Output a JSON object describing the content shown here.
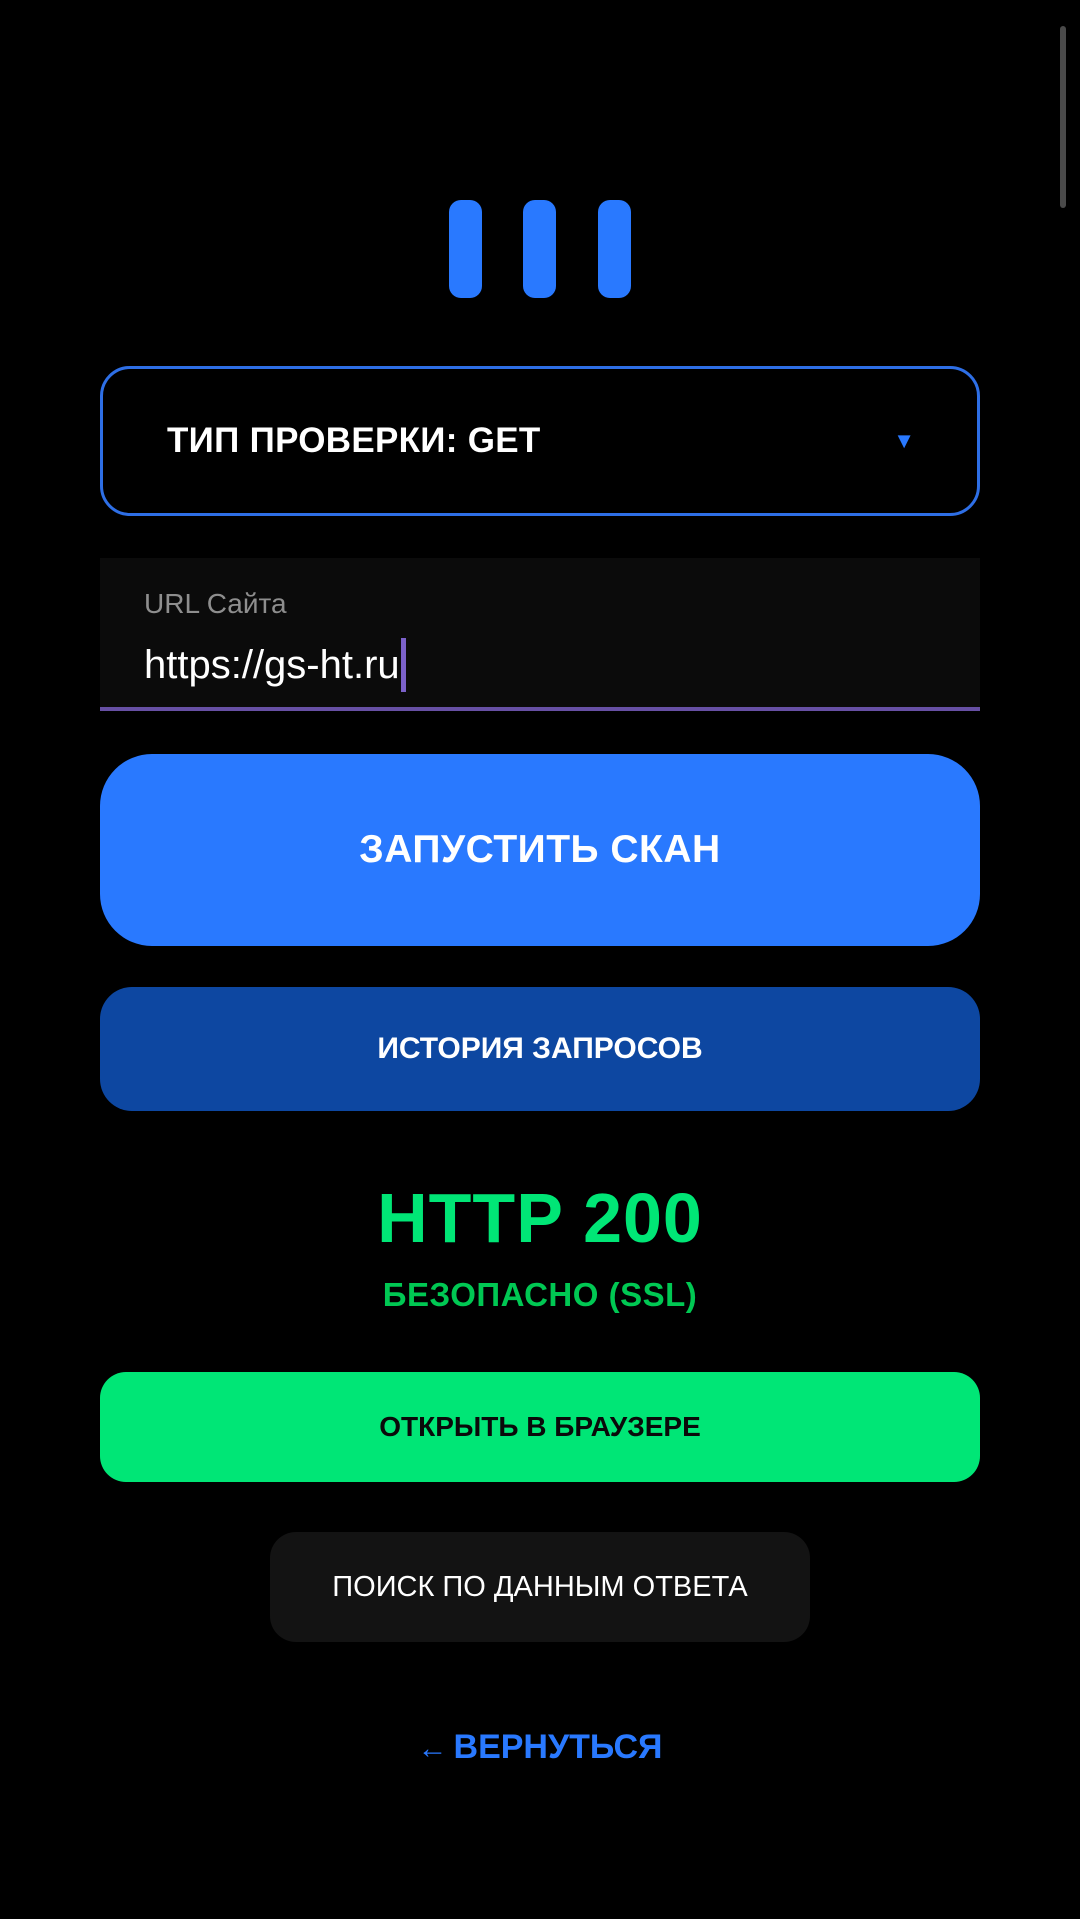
{
  "colors": {
    "background": "#000000",
    "accent_blue": "#2979ff",
    "dark_blue": "#0d47a1",
    "success_green": "#00e676",
    "input_underline": "#6750a4"
  },
  "logo": {
    "icon": "three-bars-logo-icon"
  },
  "check_type": {
    "label": "ТИП ПРОВЕРКИ: GET",
    "arrow": "▼"
  },
  "url_input": {
    "label": "URL Сайта",
    "value": "https://gs-ht.ru"
  },
  "buttons": {
    "scan": "ЗАПУСТИТЬ СКАН",
    "history": "ИСТОРИЯ ЗАПРОСОВ",
    "open_browser": "ОТКРЫТЬ В БРАУЗЕРЕ",
    "search_response": "ПОИСК ПО ДАННЫМ ОТВЕТА"
  },
  "result": {
    "status": "HTTP 200",
    "note": "БЕЗОПАСНО (SSL)"
  },
  "back": {
    "arrow": "←",
    "label": "ВЕРНУТЬСЯ"
  }
}
